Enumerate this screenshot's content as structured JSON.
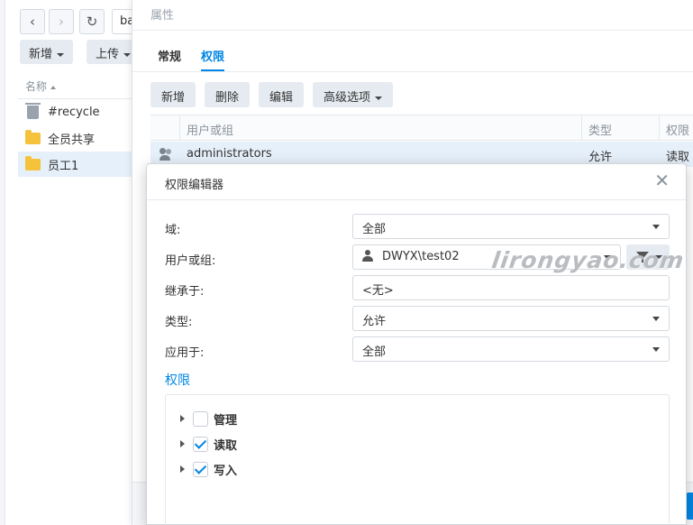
{
  "file_station": {
    "path_value": "ba",
    "toolbar": {
      "add_label": "新增",
      "upload_label": "上传"
    },
    "column_name": "名称",
    "items": [
      {
        "name": "#recycle",
        "icon": "recycle-bin-icon"
      },
      {
        "name": "全员共享",
        "icon": "folder-icon"
      },
      {
        "name": "员工1",
        "icon": "folder-icon",
        "selected": true
      }
    ]
  },
  "properties": {
    "title": "属性",
    "tabs": [
      {
        "label": "常规"
      },
      {
        "label": "权限",
        "active": true
      }
    ],
    "toolbar": {
      "add": "新增",
      "delete": "删除",
      "edit": "编辑",
      "advanced": "高级选项"
    },
    "columns": {
      "user_group": "用户或组",
      "type": "类型",
      "permission": "权限"
    },
    "rows": [
      {
        "user_group": "administrators",
        "type": "允许",
        "permission": "读取"
      }
    ]
  },
  "editor": {
    "title": "权限编辑器",
    "close_icon": "close-icon",
    "fields": {
      "domain": {
        "label": "域:",
        "value": "全部"
      },
      "user": {
        "label": "用户或组:",
        "value": "DWYX\\test02"
      },
      "inherit": {
        "label": "继承于:",
        "value": "<无>"
      },
      "type": {
        "label": "类型:",
        "value": "允许"
      },
      "apply": {
        "label": "应用于:",
        "value": "全部"
      }
    },
    "permissions_title": "权限",
    "permissions": [
      {
        "label": "管理",
        "checked": false
      },
      {
        "label": "读取",
        "checked": true
      },
      {
        "label": "写入",
        "checked": true
      }
    ]
  },
  "watermark": "lirongyao.com",
  "colors": {
    "accent": "#0086e5",
    "selection": "#e6f0fa",
    "button": "#e6ebf1"
  }
}
